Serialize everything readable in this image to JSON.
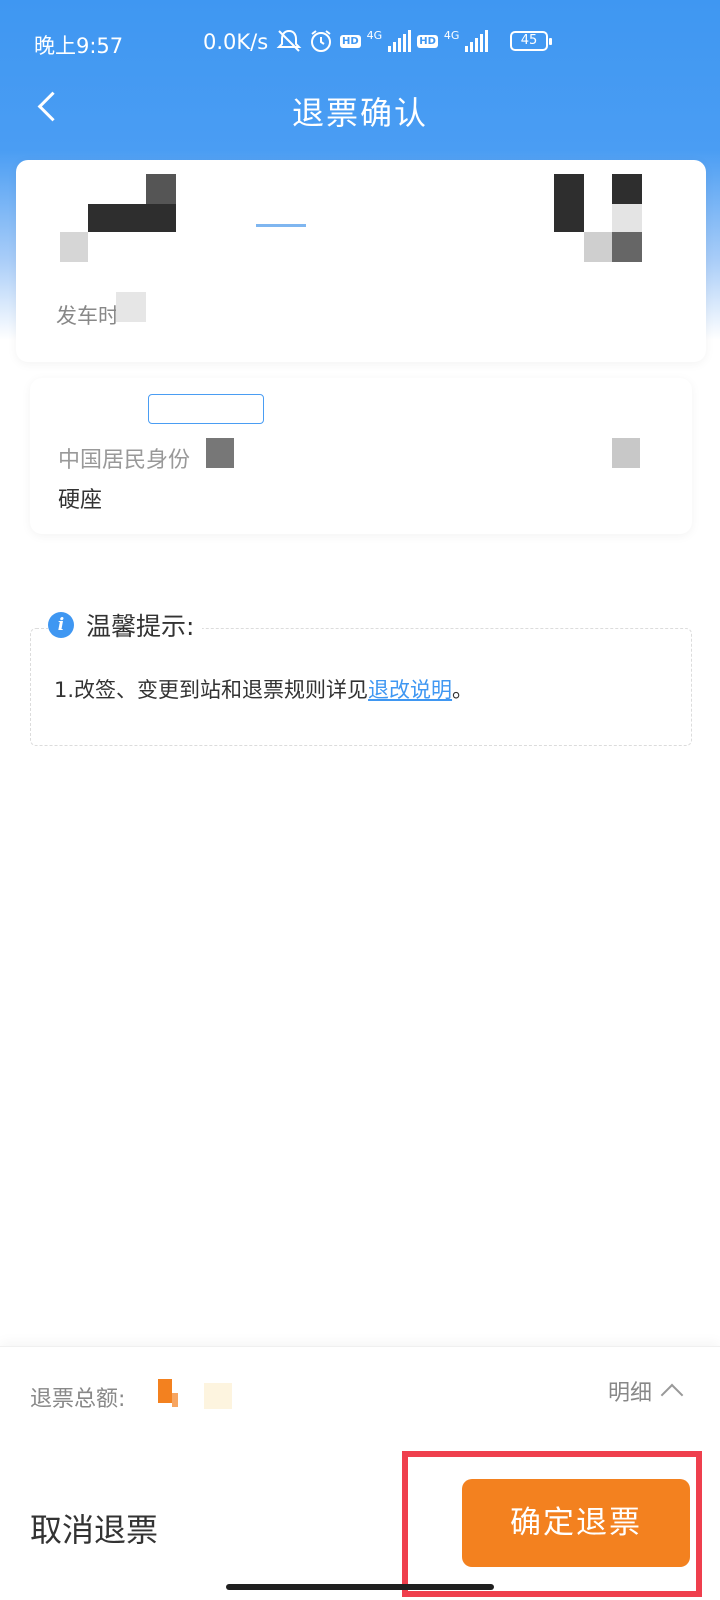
{
  "status_bar": {
    "time": "晚上9:57",
    "net_speed": "0.0K/s",
    "signal_label_1": "4G",
    "signal_label_2": "4G",
    "hd_label": "HD",
    "battery": "45"
  },
  "nav": {
    "title": "退票确认"
  },
  "trip": {
    "depart_label": "发车时"
  },
  "passenger": {
    "id_type": "中国居民身份",
    "seat": "硬座"
  },
  "tips": {
    "title": "温馨提示:",
    "text_prefix": "1.改签、变更到站和退票规则详见",
    "link": "退改说明",
    "text_suffix": "。"
  },
  "bottom": {
    "total_label": "退票总额:",
    "detail_label": "明细",
    "cancel_label": "取消退票",
    "confirm_label": "确定退票"
  },
  "colors": {
    "primary": "#3f97f2",
    "accent": "#f3811f",
    "highlight": "#ef3f4d"
  }
}
